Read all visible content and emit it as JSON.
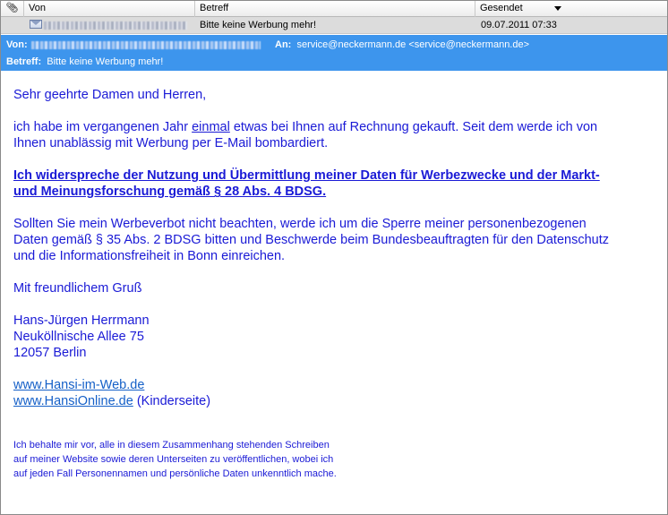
{
  "columns": {
    "attach_icon": "paperclip-icon",
    "from": "Von",
    "subject": "Betreff",
    "sent": "Gesendet"
  },
  "message_row": {
    "subject": "Bitte keine Werbung mehr!",
    "sent": "09.07.2011 07:33"
  },
  "header": {
    "from_label": "Von:",
    "to_label": "An:",
    "to_value": "service@neckermann.de <service@neckermann.de>",
    "subject_label": "Betreff:",
    "subject_value": "Bitte keine Werbung mehr!"
  },
  "body": {
    "greeting": "Sehr geehrte Damen und Herren,",
    "p1_before": "ich habe im vergangenen Jahr ",
    "p1_underlined": "einmal",
    "p1_line1_after": " etwas bei Ihnen auf Rechnung gekauft. Seit dem werde ich von",
    "p1_line2": "Ihnen unablässig mit Werbung per E-Mail bombardiert.",
    "p2_line1": "Ich widerspreche der Nutzung und Übermittlung meiner Daten für Werbezwecke und der Markt-",
    "p2_line2": "und Meinungsforschung gemäß § 28 Abs. 4 BDSG.",
    "p3_line1": "Sollten Sie mein Werbeverbot nicht beachten, werde ich um die Sperre meiner personenbezogenen",
    "p3_line2": "Daten gemäß § 35 Abs. 2 BDSG bitten und Beschwerde beim Bundesbeauftragten für den Datenschutz",
    "p3_line3": "und die Informationsfreiheit in Bonn  einreichen.",
    "closing": "Mit freundlichem Gruß",
    "sig_name": "Hans-Jürgen Herrmann",
    "sig_street": "Neuköllnische Allee 75",
    "sig_city": "12057 Berlin",
    "link1": "www.Hansi-im-Web.de",
    "link2": "www.HansiOnline.de",
    "link2_suffix": " (Kinderseite)",
    "disclaimer_line1": "Ich behalte mir vor, alle in diesem Zusammenhang stehenden Schreiben",
    "disclaimer_line2": "auf meiner Website sowie deren Unterseiten zu veröffentlichen, wobei ich",
    "disclaimer_line3": "auf jeden Fall Personennamen und persönliche Daten unkenntlich mache."
  },
  "colors": {
    "header_blue": "#3d95ed",
    "body_text": "#1a1ad6",
    "link": "#1560c8"
  }
}
